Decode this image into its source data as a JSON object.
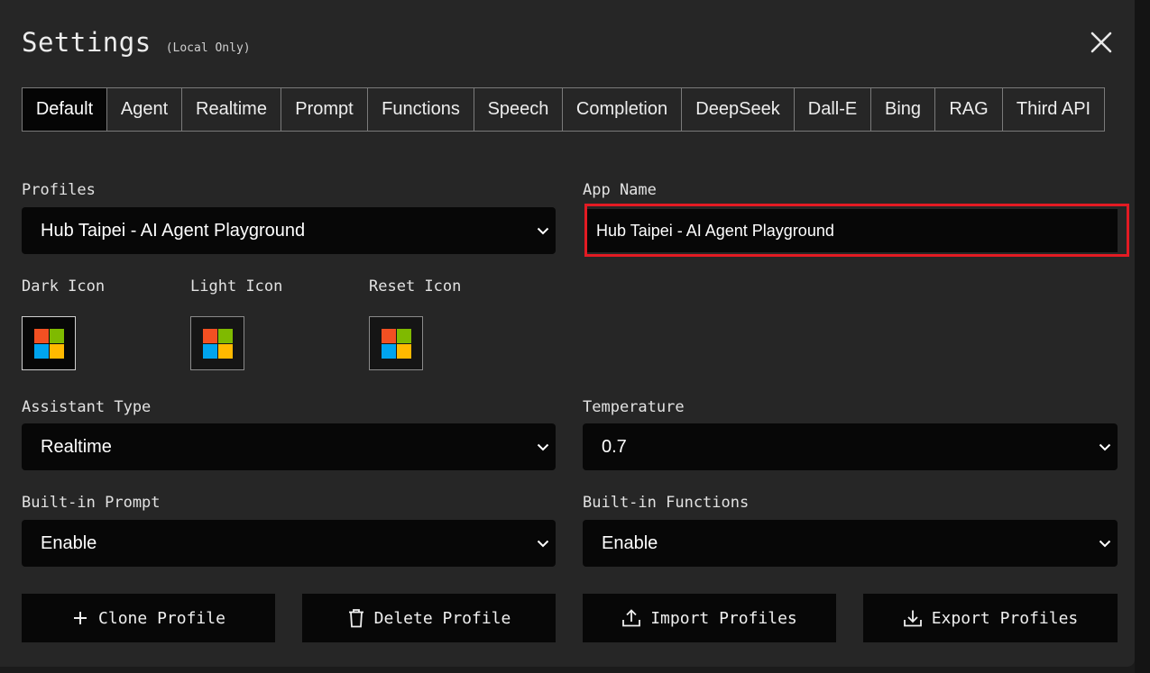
{
  "dialog": {
    "title": "Settings",
    "subtitle": "(Local Only)"
  },
  "tabs": [
    {
      "label": "Default",
      "active": true
    },
    {
      "label": "Agent",
      "active": false
    },
    {
      "label": "Realtime",
      "active": false
    },
    {
      "label": "Prompt",
      "active": false
    },
    {
      "label": "Functions",
      "active": false
    },
    {
      "label": "Speech",
      "active": false
    },
    {
      "label": "Completion",
      "active": false
    },
    {
      "label": "DeepSeek",
      "active": false
    },
    {
      "label": "Dall-E",
      "active": false
    },
    {
      "label": "Bing",
      "active": false
    },
    {
      "label": "RAG",
      "active": false
    },
    {
      "label": "Third API",
      "active": false
    }
  ],
  "profiles": {
    "label": "Profiles",
    "value": "Hub Taipei - AI Agent Playground"
  },
  "app_name": {
    "label": "App Name",
    "value": "Hub Taipei - AI Agent Playground"
  },
  "icons": {
    "dark": {
      "label": "Dark Icon",
      "icon": "microsoft-logo-icon"
    },
    "light": {
      "label": "Light Icon",
      "icon": "microsoft-logo-icon"
    },
    "reset": {
      "label": "Reset Icon",
      "icon": "microsoft-logo-icon"
    }
  },
  "assistant_type": {
    "label": "Assistant Type",
    "value": "Realtime"
  },
  "temperature": {
    "label": "Temperature",
    "value": "0.7"
  },
  "builtin_prompt": {
    "label": "Built-in Prompt",
    "value": "Enable"
  },
  "builtin_functions": {
    "label": "Built-in Functions",
    "value": "Enable"
  },
  "buttons": {
    "clone": "Clone Profile",
    "delete": "Delete Profile",
    "import": "Import Profiles",
    "export": "Export Profiles"
  },
  "colors": {
    "dialog_bg": "#262626",
    "field_bg": "#070707",
    "highlight": "#e31b23",
    "logo_red": "#f25022",
    "logo_green": "#7fba00",
    "logo_blue": "#00a4ef",
    "logo_yellow": "#ffb900"
  }
}
